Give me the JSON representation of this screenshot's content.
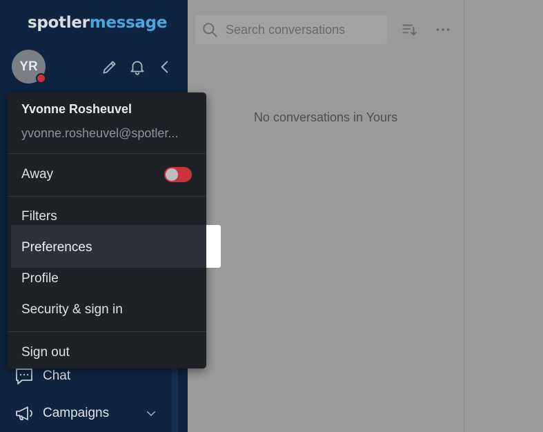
{
  "brand": {
    "part1": "spotler",
    "part2": "message"
  },
  "user": {
    "initials": "YR",
    "name": "Yvonne Rosheuvel",
    "email": "yvonne.rosheuvel@spotler..."
  },
  "menu": {
    "away_label": "Away",
    "away_enabled": false,
    "items": [
      "Filters",
      "Preferences",
      "Profile",
      "Security & sign in"
    ],
    "signout_label": "Sign out",
    "highlighted": "Preferences"
  },
  "nav": {
    "items": [
      {
        "label": "Chat",
        "icon": "chat-icon"
      },
      {
        "label": "Campaigns",
        "icon": "megaphone-icon",
        "expandable": true
      }
    ]
  },
  "search": {
    "placeholder": "Search conversations"
  },
  "main": {
    "empty_text": "No conversations in Yours"
  },
  "colors": {
    "sidebar_bg": "#0f2440",
    "brand_light": "#d9dee5",
    "brand_accent": "#4aa7d8",
    "menu_bg": "#1e2227",
    "status_red": "#c8323a",
    "overlay_gray": "#9a9a9a"
  }
}
